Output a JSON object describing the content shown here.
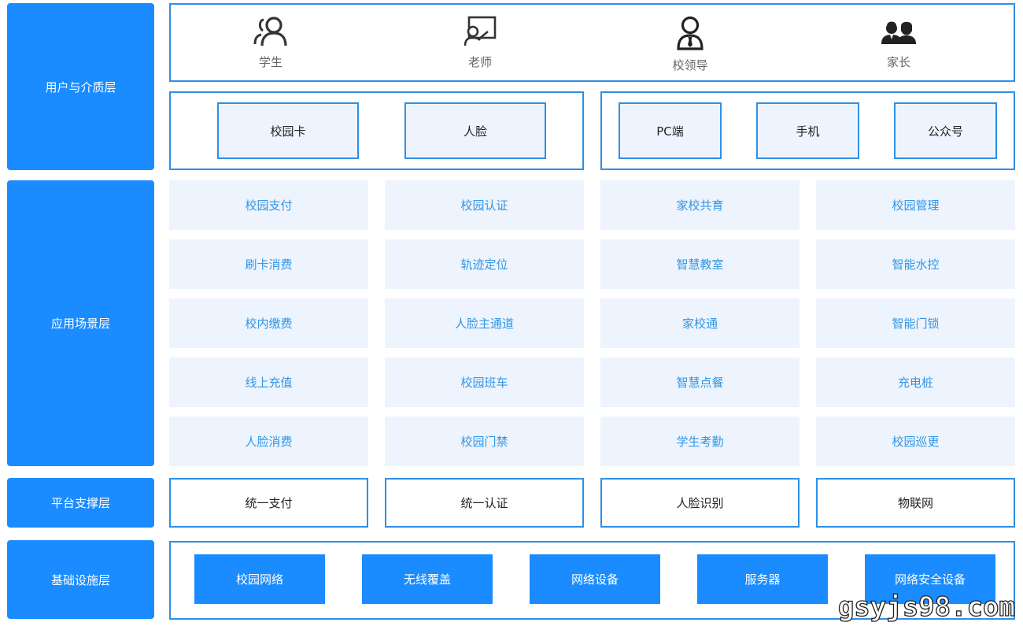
{
  "layers": {
    "user_media": "用户与介质层",
    "application": "应用场景层",
    "platform": "平台支撑层",
    "infrastructure": "基础设施层"
  },
  "users": [
    {
      "label": "学生",
      "icon": "student-icon"
    },
    {
      "label": "老师",
      "icon": "teacher-icon"
    },
    {
      "label": "校领导",
      "icon": "leader-icon"
    },
    {
      "label": "家长",
      "icon": "parents-icon"
    }
  ],
  "media": {
    "left": [
      "校园卡",
      "人脸"
    ],
    "right": [
      "PC端",
      "手机",
      "公众号"
    ]
  },
  "applications": [
    [
      "校园支付",
      "校园认证",
      "家校共育",
      "校园管理"
    ],
    [
      "刷卡消费",
      "轨迹定位",
      "智慧教室",
      "智能水控"
    ],
    [
      "校内缴费",
      "人脸主通道",
      "家校通",
      "智能门锁"
    ],
    [
      "线上充值",
      "校园班车",
      "智慧点餐",
      "充电桩"
    ],
    [
      "人脸消费",
      "校园门禁",
      "学生考勤",
      "校园巡更"
    ]
  ],
  "platform": [
    "统一支付",
    "统一认证",
    "人脸识别",
    "物联网"
  ],
  "infrastructure": [
    "校园网络",
    "无线覆盖",
    "网络设备",
    "服务器",
    "网络安全设备"
  ],
  "watermark": "gsyjs98.com",
  "colors": {
    "accent": "#1a8cff",
    "border": "#2f8fe5",
    "tile_bg": "#edf4fd",
    "tile_text": "#3196e6"
  }
}
